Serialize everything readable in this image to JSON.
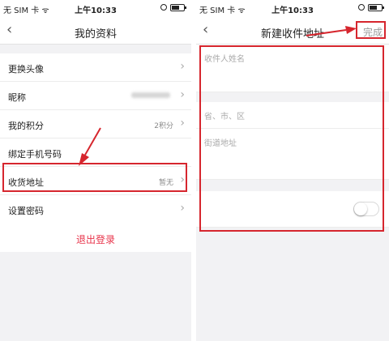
{
  "left": {
    "status": {
      "carrier": "无 SIM 卡 ᯤ",
      "time": "上午10:33"
    },
    "nav": {
      "back": "‹",
      "title": "我的资料"
    },
    "items": [
      {
        "label": "更换头像",
        "value": "",
        "chev": "›"
      },
      {
        "label": "昵称",
        "value": "",
        "chev": "›"
      },
      {
        "label": "我的积分",
        "value": "2积分",
        "chev": "›"
      },
      {
        "label": "绑定手机号码",
        "value": "",
        "chev": ""
      },
      {
        "label": "收货地址",
        "value": "暂无",
        "chev": "›"
      },
      {
        "label": "设置密码",
        "value": "",
        "chev": "›"
      }
    ],
    "logout": "退出登录"
  },
  "right": {
    "status": {
      "carrier": "无 SIM 卡 ᯤ",
      "time": "上午10:33"
    },
    "nav": {
      "back": "‹",
      "title": "新建收件地址",
      "done": "完成"
    },
    "fields": {
      "name_placeholder": "收件人姓名",
      "region_placeholder": "省、市、区",
      "street_placeholder": "街道地址"
    },
    "default_toggle": {
      "on": false
    }
  },
  "colors": {
    "highlight": "#d6262e",
    "logout": "#e8344b",
    "background": "#f2f2f4"
  }
}
